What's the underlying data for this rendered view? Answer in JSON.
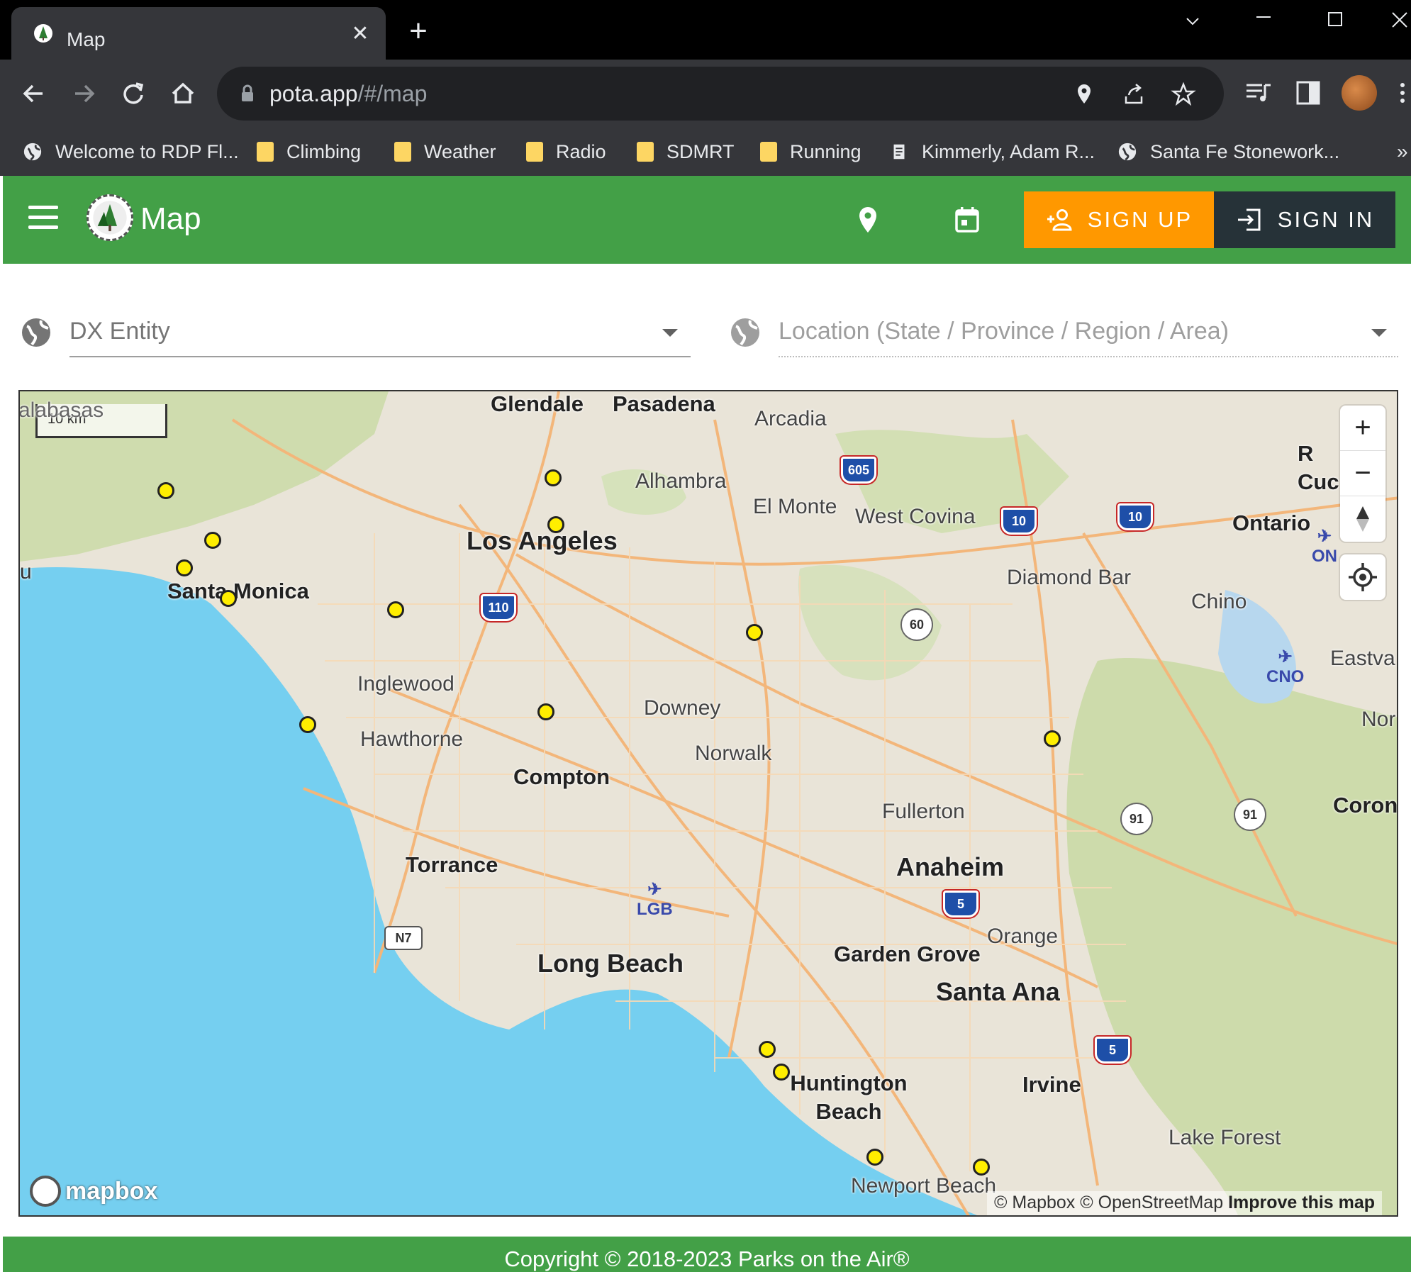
{
  "browser": {
    "tab_title": "Map",
    "url_host": "pota.app",
    "url_path": "/#/map",
    "bookmarks": [
      {
        "label": "Welcome to RDP Fl...",
        "icon": "globe-icon"
      },
      {
        "label": "Climbing",
        "icon": "folder-icon"
      },
      {
        "label": "Weather",
        "icon": "folder-icon"
      },
      {
        "label": "Radio",
        "icon": "folder-icon"
      },
      {
        "label": "SDMRT",
        "icon": "folder-icon"
      },
      {
        "label": "Running",
        "icon": "folder-icon"
      },
      {
        "label": "Kimmerly, Adam R...",
        "icon": "page-icon"
      },
      {
        "label": "Santa Fe Stonework...",
        "icon": "globe-icon"
      }
    ],
    "bookmarks_overflow": "»"
  },
  "header": {
    "title": "Map",
    "signup_label": "SIGN UP",
    "signin_label": "SIGN IN",
    "brand_color": "#43a047",
    "signup_color": "#ff9800",
    "signin_color": "#263238"
  },
  "filters": {
    "dx_entity": "DX Entity",
    "location": "Location (State / Province / Region / Area)"
  },
  "map": {
    "scale_label": "10 km",
    "cities": {
      "calabasas": "alabasas",
      "glendale": "Glendale",
      "pasadena": "Pasadena",
      "arcadia": "Arcadia",
      "alhambra": "Alhambra",
      "el_monte": "El Monte",
      "west_covina": "West Covina",
      "rancho": "R",
      "rancho2": "Cuc",
      "ontario": "Ontario",
      "los_angeles": "Los Angeles",
      "diamond_bar": "Diamond Bar",
      "chino": "Chino",
      "santa_monica": "Santa Monica",
      "inglewood": "Inglewood",
      "downey": "Downey",
      "eastvale": "Eastva",
      "hawthorne": "Hawthorne",
      "norwalk": "Norwalk",
      "norco": "Nor",
      "compton": "Compton",
      "fullerton": "Fullerton",
      "corona": "Coron",
      "torrance": "Torrance",
      "anaheim": "Anaheim",
      "orange": "Orange",
      "long_beach": "Long Beach",
      "garden_grove": "Garden Grove",
      "santa_ana": "Santa Ana",
      "huntington_beach": "Huntington Beach",
      "irvine": "Irvine",
      "lake_forest": "Lake Forest",
      "newport_beach": "Newport Beach",
      "u": "u"
    },
    "shields": {
      "i605": "605",
      "i10a": "10",
      "i10b": "10",
      "i110": "110",
      "ca60": "60",
      "ca91a": "91",
      "ca91b": "91",
      "i5a": "5",
      "i5b": "5",
      "n7": "N7"
    },
    "airports": {
      "lgb": "LGB",
      "cno": "CNO",
      "ont": "ON"
    },
    "logo_label": "mapbox",
    "attribution": "© Mapbox © OpenStreetMap",
    "improve_label": "Improve this map",
    "spot_color": "#ffee00",
    "park_spot_count": 20
  },
  "footer": {
    "copyright": "Copyright © 2018-2023 Parks on the Air®"
  }
}
